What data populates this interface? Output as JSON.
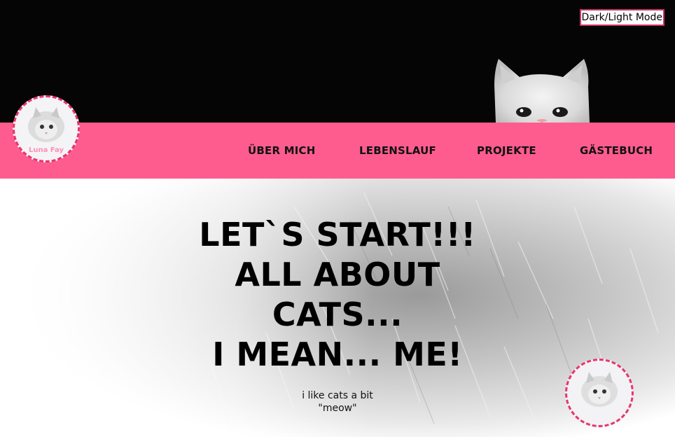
{
  "header": {
    "mode_toggle_label": "Dark/Light Mode"
  },
  "logo": {
    "text": "Luna Fay"
  },
  "nav": {
    "items": [
      {
        "label": "ÜBER MICH"
      },
      {
        "label": "LEBENSLAUF"
      },
      {
        "label": "PROJEKTE"
      },
      {
        "label": "GÄSTEBUCH"
      }
    ]
  },
  "hero": {
    "headline_lines": [
      "LET`S START!!!",
      "ALL ABOUT",
      "CATS...",
      "I MEAN... ME!"
    ],
    "tagline_lines": [
      "i like cats a bit",
      "\"meow\""
    ]
  },
  "icons": {
    "logo": "cat-photo-icon",
    "header_image": "cat-peeking-icon",
    "corner_avatar": "cat-photo-icon"
  },
  "colors": {
    "accent_pink": "#fe5c8f",
    "dashed_border": "#e8356f",
    "header_bg": "#050505",
    "logo_text": "#ff8fb7"
  }
}
